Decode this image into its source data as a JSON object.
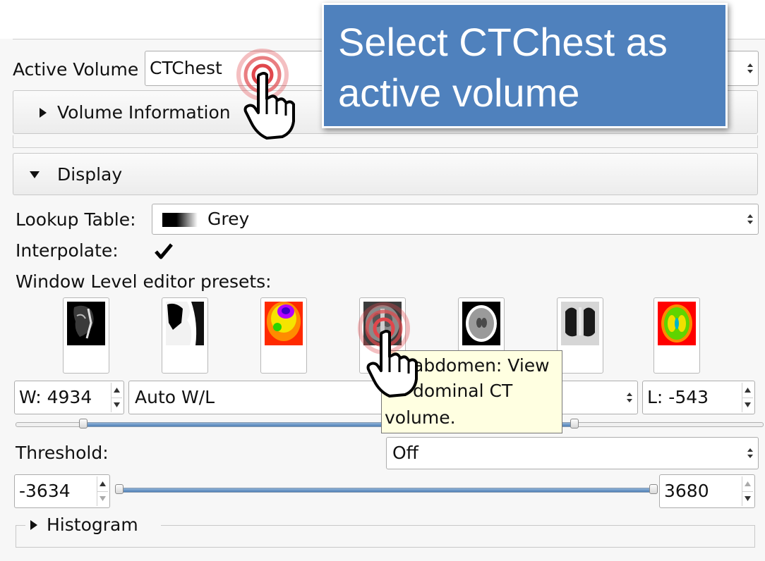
{
  "active_volume": {
    "label": "Active Volume",
    "value": "CTChest"
  },
  "sections": {
    "volume_information": "Volume Information",
    "display": "Display",
    "histogram": "Histogram"
  },
  "display": {
    "lookup_table_label": "Lookup Table:",
    "lookup_table_value": "Grey",
    "interpolate_label": "Interpolate:",
    "interpolate_checked": true,
    "presets_label": "Window Level editor presets:",
    "presets": [
      {
        "icon": "ct-bone-preset-icon"
      },
      {
        "icon": "ct-air-preset-icon"
      },
      {
        "icon": "pet-preset-icon"
      },
      {
        "icon": "ct-abdomen-preset-icon"
      },
      {
        "icon": "ct-brain-preset-icon"
      },
      {
        "icon": "ct-lung-preset-icon"
      },
      {
        "icon": "dti-preset-icon"
      }
    ],
    "window_value": "W: 4934",
    "wl_mode": "Auto W/L",
    "level_value": "L: -543",
    "threshold_label": "Threshold:",
    "threshold_mode": "Off",
    "threshold_min": "-3634",
    "threshold_max": "3680"
  },
  "tooltip": {
    "line1": "abdomen: View",
    "line2": "dominal CT",
    "line3": "volume."
  },
  "callout": {
    "line1": "Select CTChest as",
    "line2": "active volume"
  },
  "colors": {
    "callout_bg": "#4f81bd",
    "tooltip_bg": "#ffffe1",
    "click_ring": "#e0474c"
  }
}
